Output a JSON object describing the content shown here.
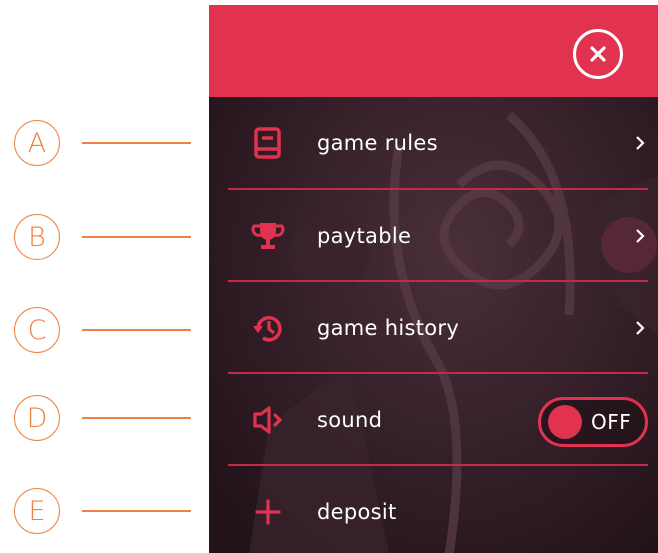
{
  "callouts": [
    "A",
    "B",
    "C",
    "D",
    "E"
  ],
  "menu": {
    "items": [
      {
        "label": "game rules",
        "icon": "book-icon"
      },
      {
        "label": "paytable",
        "icon": "trophy-icon"
      },
      {
        "label": "game history",
        "icon": "history-icon"
      },
      {
        "label": "sound",
        "icon": "speaker-icon",
        "toggle_state": "OFF"
      },
      {
        "label": "deposit",
        "icon": "plus-icon"
      }
    ]
  },
  "colors": {
    "accent": "#e1324f",
    "panel_bg": "#2b1a23",
    "callout": "#f08040",
    "text": "#ffffff"
  }
}
